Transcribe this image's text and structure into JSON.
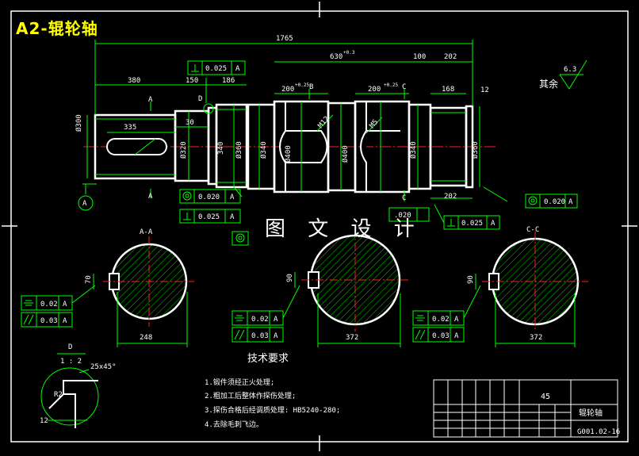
{
  "drawing": {
    "title": "A2-辊轮轴",
    "watermark": "图 文 设 计",
    "surface_note_label": "其余",
    "surface_roughness": "6.3"
  },
  "dimensions": {
    "overall_length": "1765",
    "d630": "630",
    "d630_tol": "+0.3",
    "d100": "100",
    "d202_top": "202",
    "d380": "380",
    "d150": "150",
    "d186": "186",
    "d200_left": "200",
    "d200_left_tol": "+0.25",
    "d200_right": "200",
    "d200_right_tol": "+0.25",
    "d168": "168",
    "d12_right": "12",
    "d335": "335",
    "d30": "30",
    "dia300": "Ø300",
    "dia320": "Ø320",
    "d340a": "340",
    "dia360a": "Ø360",
    "dia340b": "Ø340",
    "dia400a": "Ø400",
    "dia400b": "Ø400",
    "dia340c": "Ø340",
    "dia360b": "Ø360",
    "d202_bottom": "202",
    "r_m2": "M12",
    "r_m5": "M5",
    "dim_248": "248",
    "dim_372a": "372",
    "dim_372b": "372",
    "key_70": "70",
    "key_90a": "90",
    "key_90b": "90"
  },
  "labels": {
    "A_top": "A",
    "A_bottom": "A",
    "B_top": "B",
    "C_top": "C",
    "C_bottom": "C",
    "D_mark": "D",
    "section_AA": "A-A",
    "section_CC": "C-C",
    "detail_D": "D",
    "detail_scale": "1 : 2",
    "chamfer": "25x45°",
    "r2": "R2",
    "d12_detail": "12",
    "datum_A": "A"
  },
  "tolerances": {
    "t_perp_top": "0.025",
    "t_perp_top_ref": "A",
    "t_circ1": "0.020",
    "t_circ1_ref": "A",
    "t_perp2": "0.025",
    "t_perp2_ref": "A",
    "t_circ_right": "0.020",
    "t_circ_right_ref": "A",
    "t_perp_right": "0.025",
    "t_perp_right_ref": "A",
    "t_020b": ".020",
    "sec1_a": "0.02",
    "sec1_a_ref": "A",
    "sec1_b": "0.03",
    "sec1_b_ref": "A",
    "sec2_a": "0.02",
    "sec2_a_ref": "A",
    "sec2_b": "0.03",
    "sec2_b_ref": "A",
    "sec3_a": "0.02",
    "sec3_a_ref": "A",
    "sec3_b": "0.03",
    "sec3_b_ref": "A"
  },
  "notes": {
    "heading": "技术要求",
    "n1": "1.锻件须经正火处理;",
    "n2": "2.粗加工后整体作探伤处理;",
    "n3": "3.探伤合格后经调质处理: HB5240-280;",
    "n4": "4.去除毛刺飞边。"
  },
  "titleblock": {
    "material": "45",
    "part_name": "辊轮轴",
    "drawing_no": "G001.02-16"
  },
  "colors": {
    "line": "#00ff00",
    "outline": "#ffffff",
    "center": "#ff2020",
    "text": "#ffffff",
    "title": "#ffff00"
  }
}
